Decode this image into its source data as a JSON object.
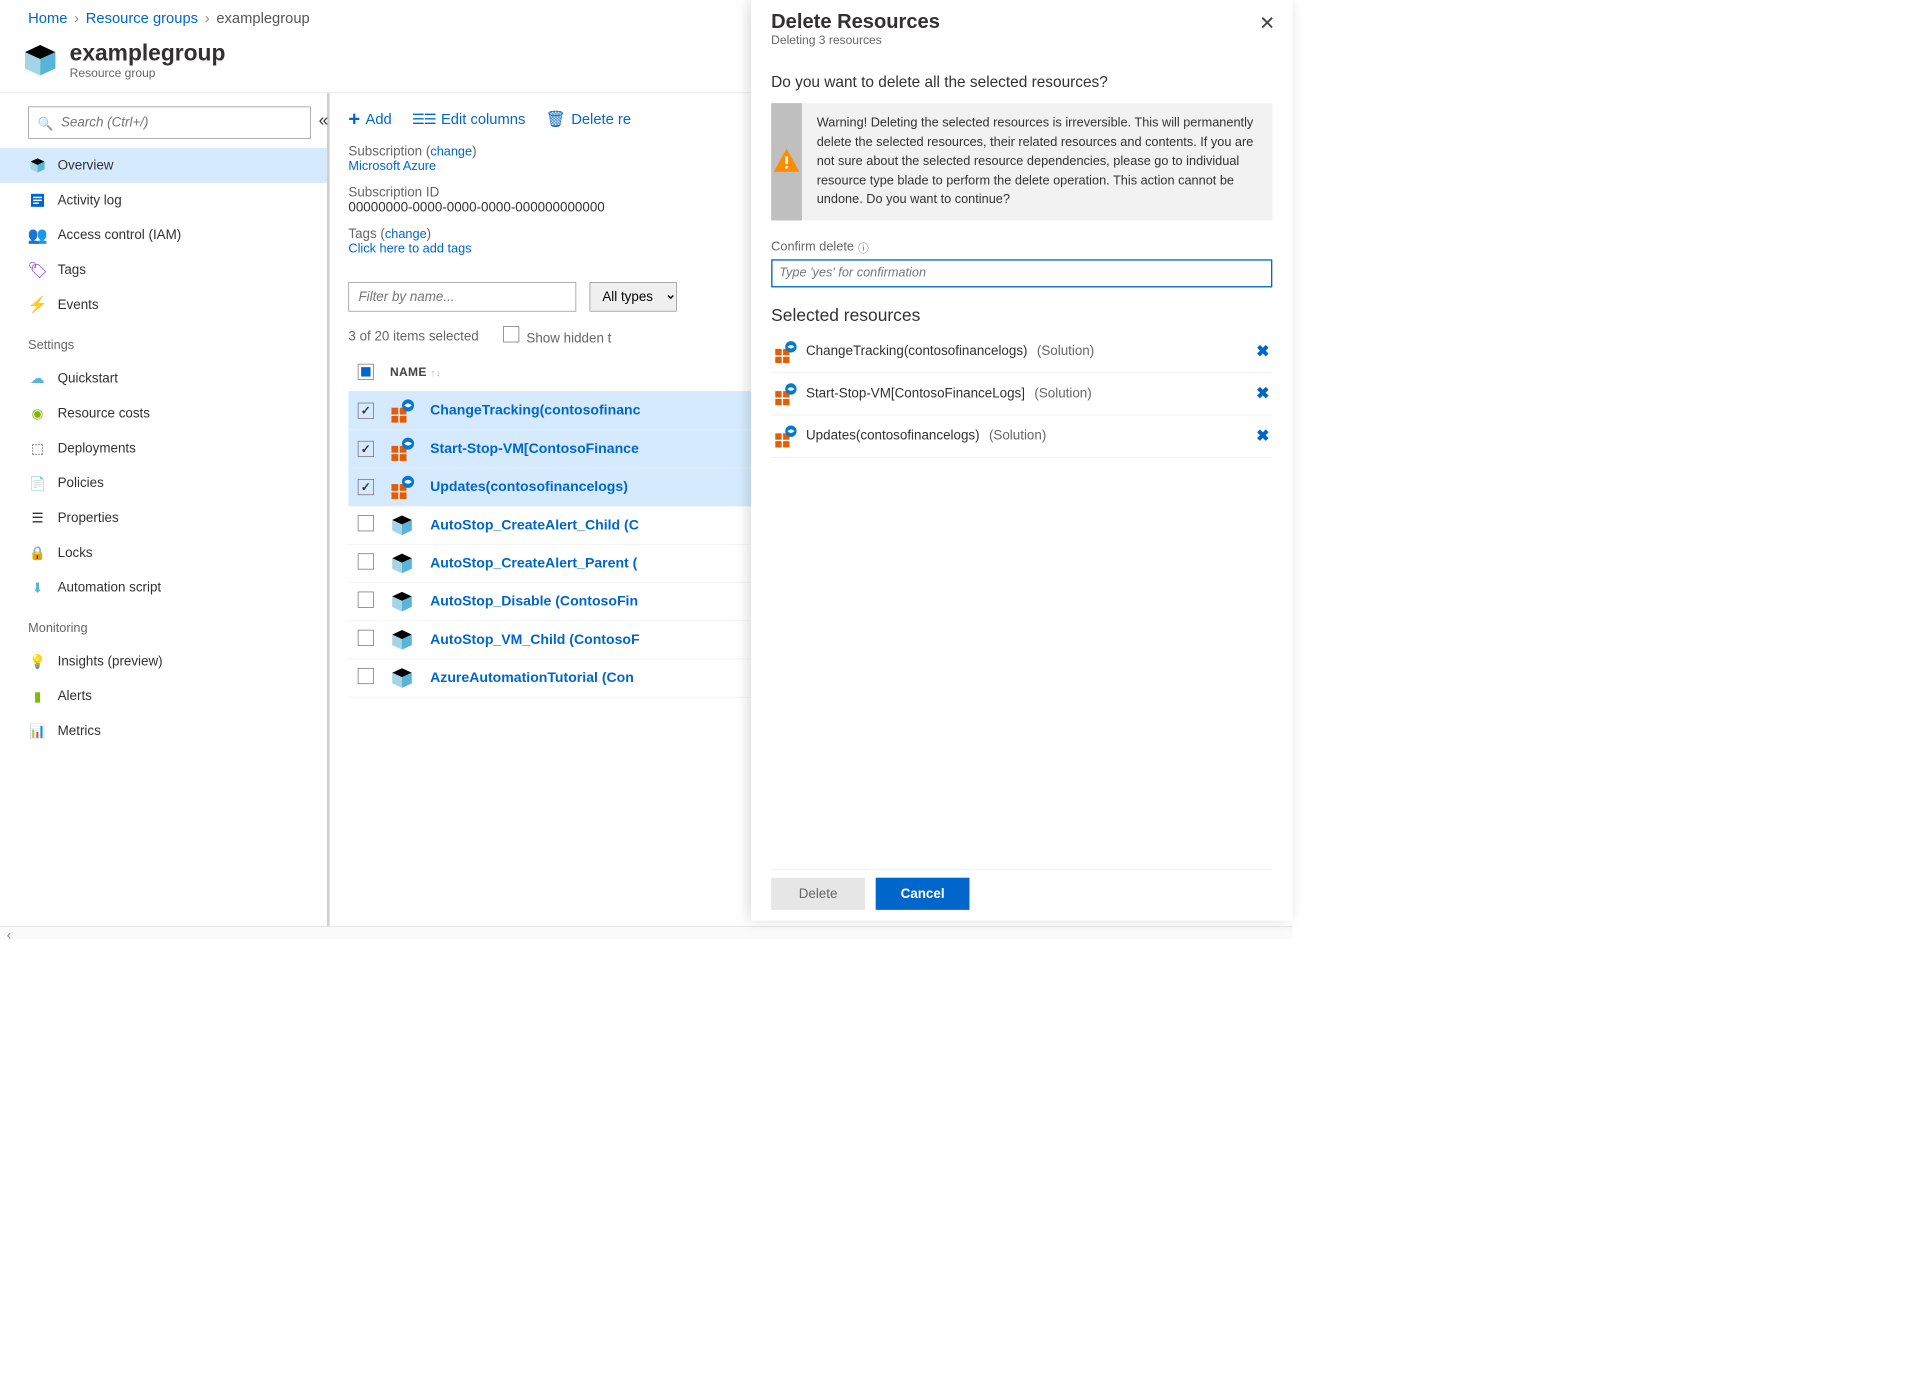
{
  "breadcrumb": {
    "home": "Home",
    "rg": "Resource groups",
    "current": "examplegroup"
  },
  "header": {
    "title": "examplegroup",
    "subtitle": "Resource group"
  },
  "sidebar": {
    "search_ph": "Search (Ctrl+/)",
    "items": [
      "Overview",
      "Activity log",
      "Access control (IAM)",
      "Tags",
      "Events"
    ],
    "settings_label": "Settings",
    "settings_items": [
      "Quickstart",
      "Resource costs",
      "Deployments",
      "Policies",
      "Properties",
      "Locks",
      "Automation script"
    ],
    "monitoring_label": "Monitoring",
    "monitoring_items": [
      "Insights (preview)",
      "Alerts",
      "Metrics"
    ]
  },
  "toolbar": {
    "add": "Add",
    "edit_cols": "Edit columns",
    "delete_rg": "Delete re"
  },
  "details": {
    "sub_label": "Subscription",
    "change": "change",
    "sub_link": "Microsoft Azure",
    "subid_label": "Subscription ID",
    "subid": "00000000-0000-0000-0000-000000000000",
    "tags_label": "Tags",
    "tags_link": "Click here to add tags"
  },
  "filter": {
    "ph": "Filter by name...",
    "types": "All types"
  },
  "list": {
    "count": "3 of 20 items selected",
    "show_hidden": "Show hidden t",
    "name_col": "NAME",
    "rows": [
      {
        "name": "ChangeTracking(contosofinanc",
        "sel": true,
        "icon": "solution"
      },
      {
        "name": "Start-Stop-VM[ContosoFinance",
        "sel": true,
        "icon": "solution"
      },
      {
        "name": "Updates(contosofinancelogs)",
        "sel": true,
        "icon": "solution"
      },
      {
        "name": "AutoStop_CreateAlert_Child (C",
        "sel": false,
        "icon": "cube"
      },
      {
        "name": "AutoStop_CreateAlert_Parent (",
        "sel": false,
        "icon": "cube"
      },
      {
        "name": "AutoStop_Disable (ContosoFin",
        "sel": false,
        "icon": "cube"
      },
      {
        "name": "AutoStop_VM_Child (ContosoF",
        "sel": false,
        "icon": "cube"
      },
      {
        "name": "AzureAutomationTutorial (Con",
        "sel": false,
        "icon": "cube"
      }
    ]
  },
  "panel": {
    "title": "Delete Resources",
    "subtitle": "Deleting 3 resources",
    "question": "Do you want to delete all the selected resources?",
    "warning": "Warning! Deleting the selected resources is irreversible. This will permanently delete the selected resources, their related resources and contents. If you are not sure about the selected resource dependencies, please go to individual resource type blade to perform the delete operation. This action cannot be undone. Do you want to continue?",
    "confirm_label": "Confirm delete",
    "confirm_ph": "Type 'yes' for confirmation",
    "selected_title": "Selected resources",
    "selected": [
      {
        "name": "ChangeTracking(contosofinancelogs)",
        "type": "(Solution)"
      },
      {
        "name": "Start-Stop-VM[ContosoFinanceLogs]",
        "type": "(Solution)"
      },
      {
        "name": "Updates(contosofinancelogs)",
        "type": "(Solution)"
      }
    ],
    "btn_delete": "Delete",
    "btn_cancel": "Cancel"
  }
}
